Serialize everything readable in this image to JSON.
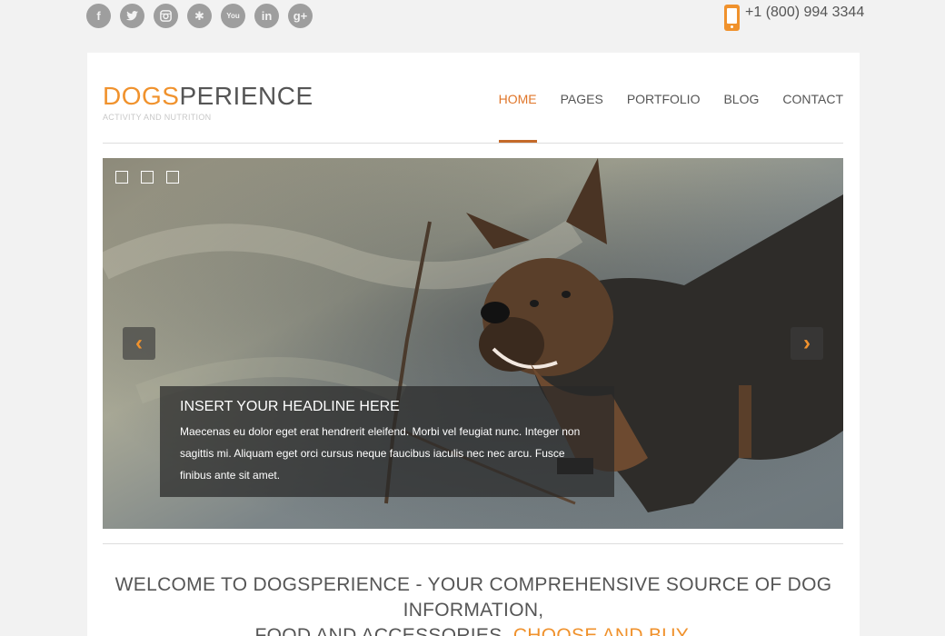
{
  "social": [
    {
      "name": "facebook-icon",
      "glyph": "f"
    },
    {
      "name": "twitter-icon",
      "glyph": "t"
    },
    {
      "name": "instagram-icon",
      "glyph": "◎"
    },
    {
      "name": "yelp-icon",
      "glyph": "✱"
    },
    {
      "name": "youtube-icon",
      "glyph": "You"
    },
    {
      "name": "linkedin-icon",
      "glyph": "in"
    },
    {
      "name": "googleplus-icon",
      "glyph": "g+"
    }
  ],
  "contact": {
    "phone": "+1 (800) 994 3344"
  },
  "logo": {
    "title_accent": "DOGS",
    "title_rest": "PERIENCE",
    "subtitle": "ACTIVITY AND NUTRITION"
  },
  "nav": {
    "items": [
      "HOME",
      "PAGES",
      "PORTFOLIO",
      "BLOG",
      "CONTACT"
    ],
    "active": "HOME"
  },
  "slider": {
    "arrow_prev": "‹",
    "arrow_next": "›",
    "caption_title": "INSERT YOUR HEADLINE HERE",
    "caption_text": "Maecenas eu dolor eget erat hendrerit eleifend. Morbi vel feugiat nunc. Integer non sagittis mi. Aliquam eget orci cursus neque faucibus iaculis nec nec arcu. Fusce finibus ante sit amet."
  },
  "welcome": {
    "line1": "WELCOME TO DOGSPERIENCE - YOUR COMPREHENSIVE SOURCE OF DOG INFORMATION,",
    "line2": "FOOD AND ACCESSORIES.",
    "highlight": "CHOOSE AND BUY."
  },
  "colors": {
    "accent": "#f0922d",
    "nav_active": "#e0762a",
    "background": "#f2f2f2"
  }
}
